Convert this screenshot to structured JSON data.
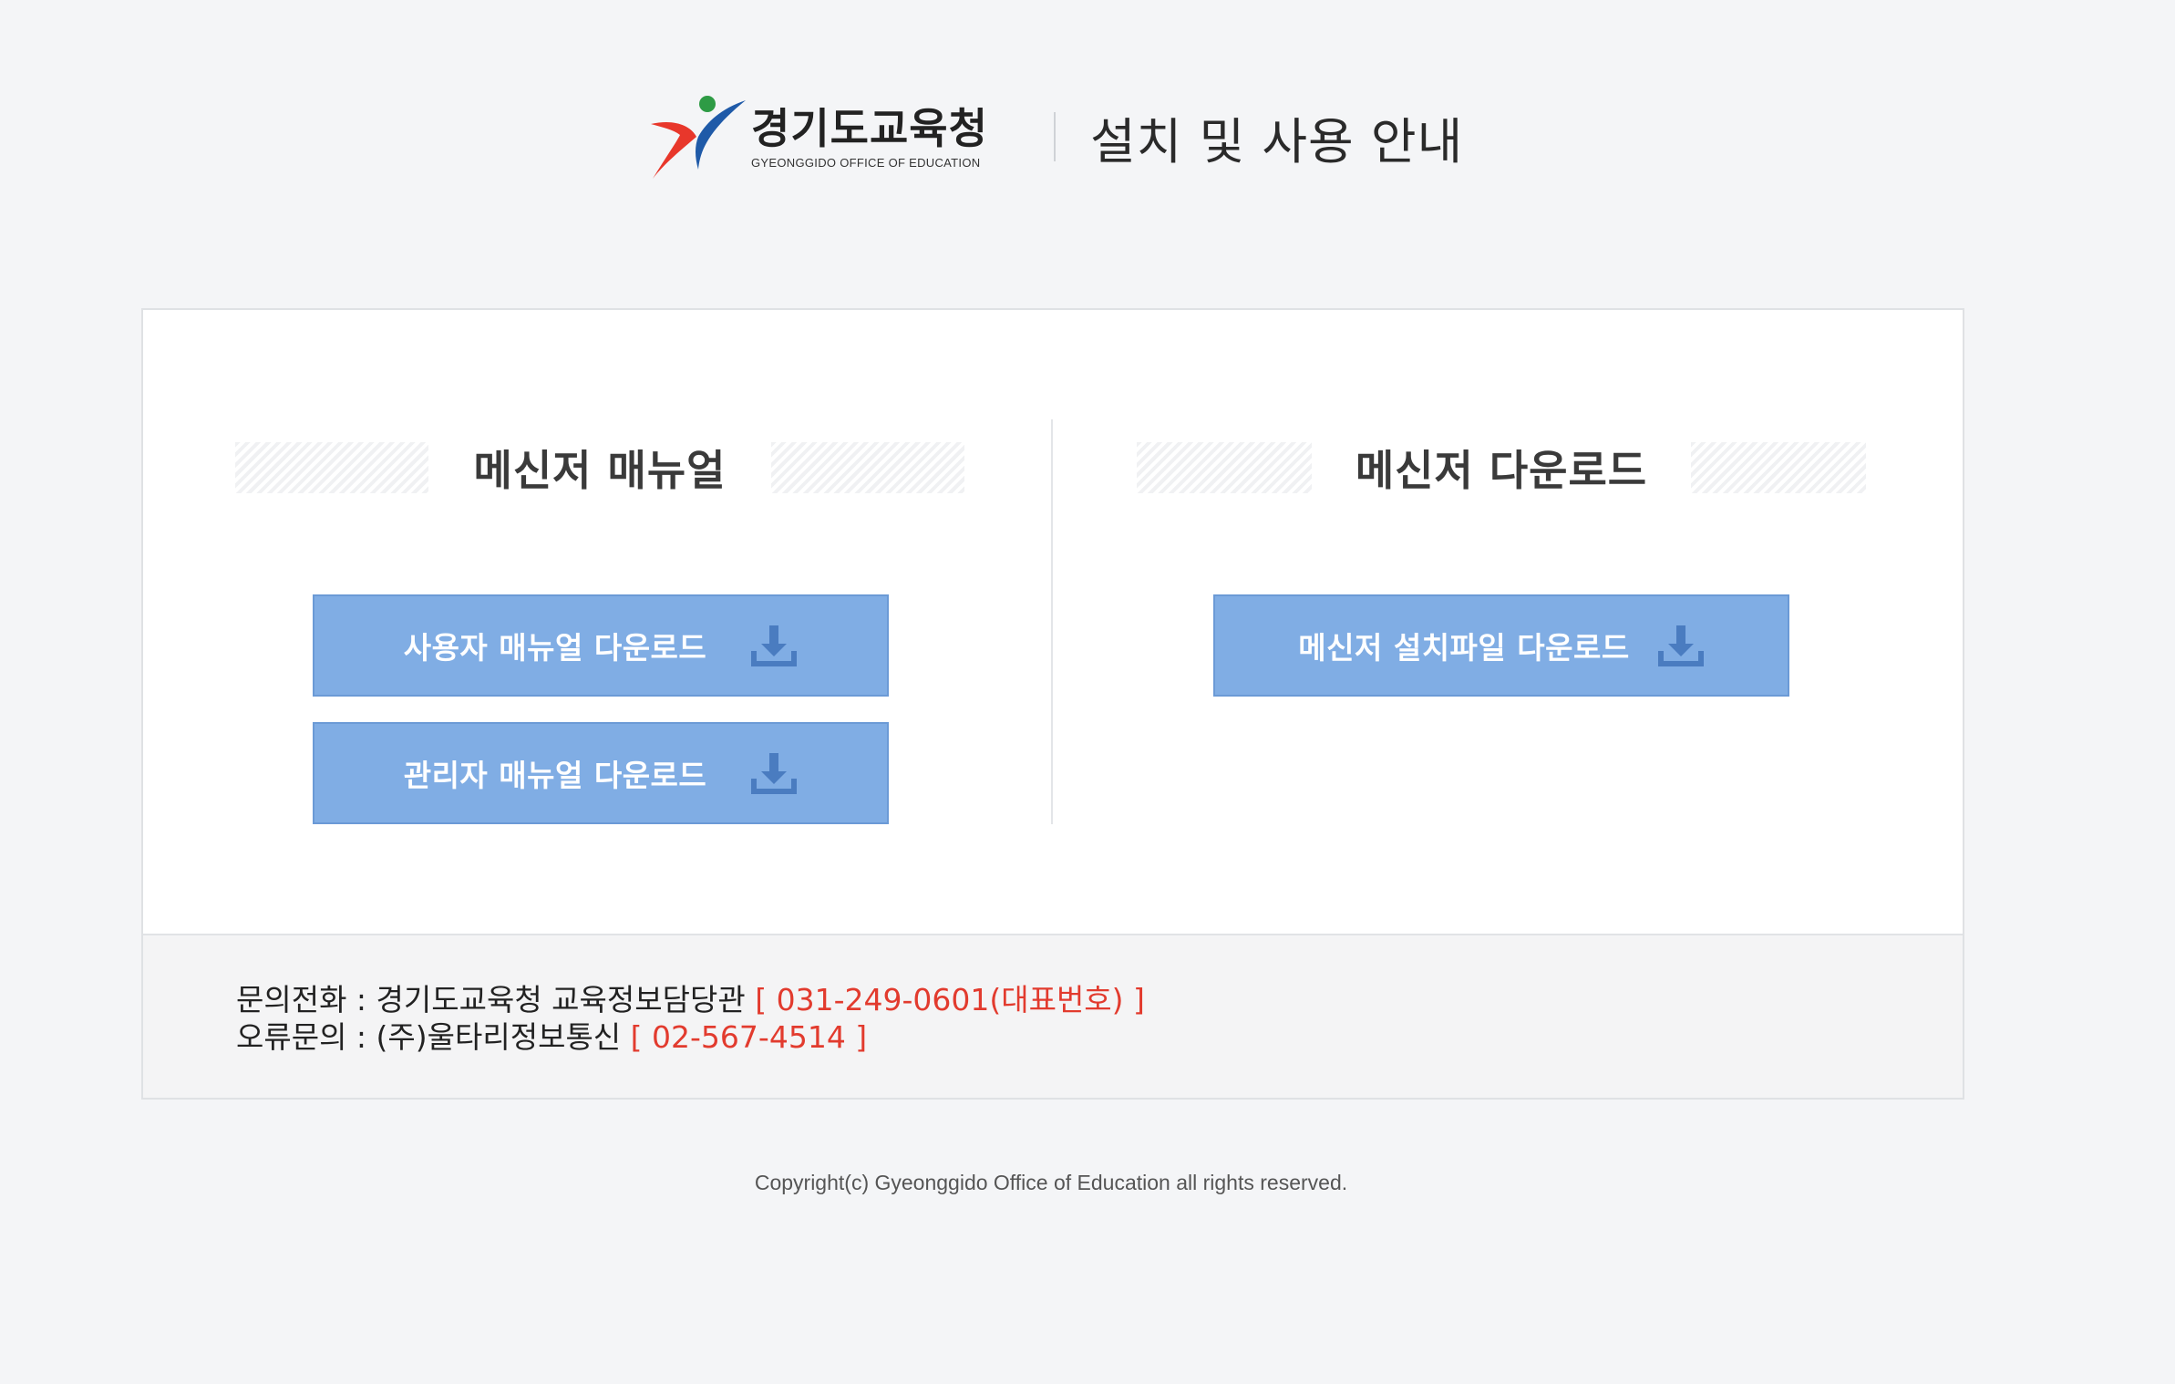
{
  "header": {
    "logo_korean": "경기도교육청",
    "logo_english": "GYEONGGIDO OFFICE OF EDUCATION",
    "title": "설치 및 사용 안내"
  },
  "manual_section": {
    "heading": "메신저 매뉴얼",
    "buttons": [
      {
        "label": "사용자 매뉴얼 다운로드",
        "icon": "download-icon"
      },
      {
        "label": "관리자 매뉴얼 다운로드",
        "icon": "download-icon"
      }
    ]
  },
  "download_section": {
    "heading": "메신저 다운로드",
    "buttons": [
      {
        "label": "메신저 설치파일 다운로드",
        "icon": "download-icon"
      }
    ]
  },
  "contact": {
    "phone_label": "문의전화 : 경기도교육청 교육정보담당관",
    "phone_number": "[ 031-249-0601(대표번호) ]",
    "error_label": "오류문의 : (주)울타리정보통신",
    "error_number": "[ 02-567-4514 ]"
  },
  "copyright": "Copyright(c) Gyeonggido Office of Education all rights reserved.",
  "colors": {
    "background": "#f4f5f7",
    "button": "#80ade4",
    "button_border": "#6b9ad6",
    "phone_accent": "#e23b2e",
    "icon": "#4a7cc0"
  }
}
